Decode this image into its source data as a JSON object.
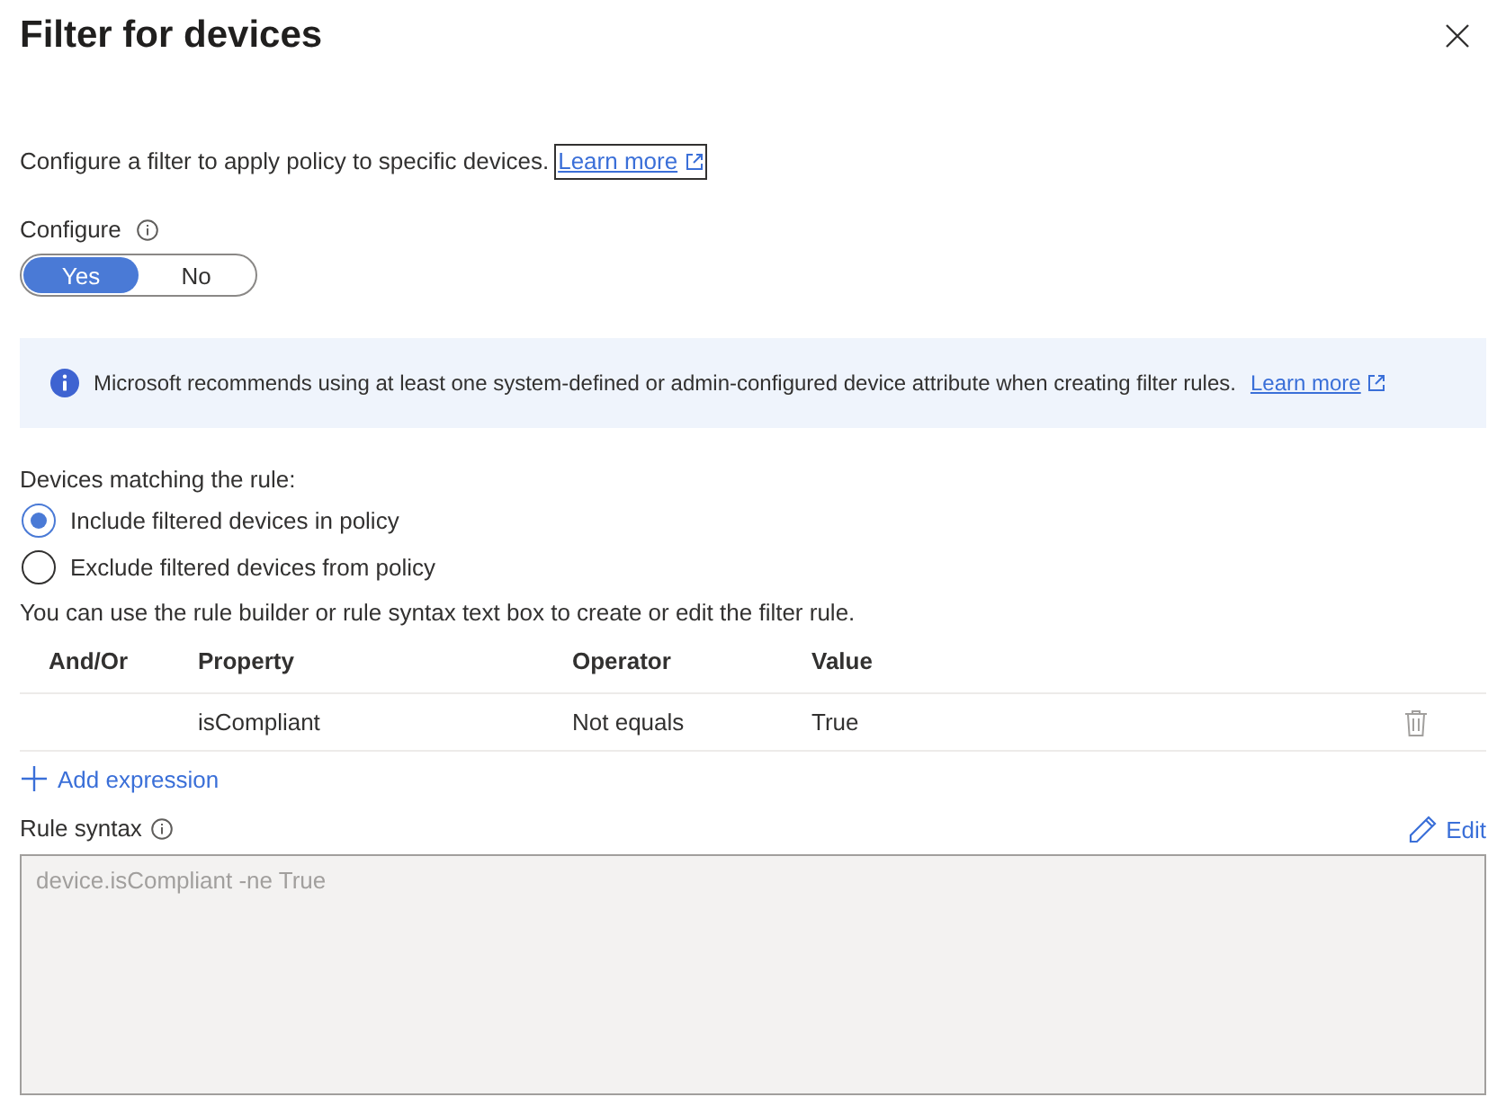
{
  "panel": {
    "title": "Filter for devices"
  },
  "intro": {
    "text": "Configure a filter to apply policy to specific devices.",
    "link": {
      "label": "Learn more",
      "focused": true
    }
  },
  "configure": {
    "label": "Configure",
    "options": [
      {
        "label": "Yes",
        "selected": true
      },
      {
        "label": "No",
        "selected": false
      }
    ]
  },
  "info_banner": {
    "text": "Microsoft recommends using at least one system-defined or admin-configured device attribute when creating filter rules.",
    "link": "Learn more"
  },
  "matching": {
    "label": "Devices matching the rule:",
    "options": [
      {
        "label": "Include filtered devices in policy",
        "selected": true
      },
      {
        "label": "Exclude filtered devices from policy",
        "selected": false
      }
    ]
  },
  "hint": "You can use the rule builder or rule syntax text box to create or edit the filter rule.",
  "rules_table": {
    "columns": [
      "And/Or",
      "Property",
      "Operator",
      "Value"
    ],
    "rows": [
      {
        "property": "isCompliant",
        "operator": "Not equals",
        "value": "True"
      }
    ]
  },
  "add_expression": "Add expression",
  "rule_syntax": {
    "label": "Rule syntax",
    "edit": "Edit",
    "value": "device.isCompliant -ne True",
    "disabled": true
  }
}
